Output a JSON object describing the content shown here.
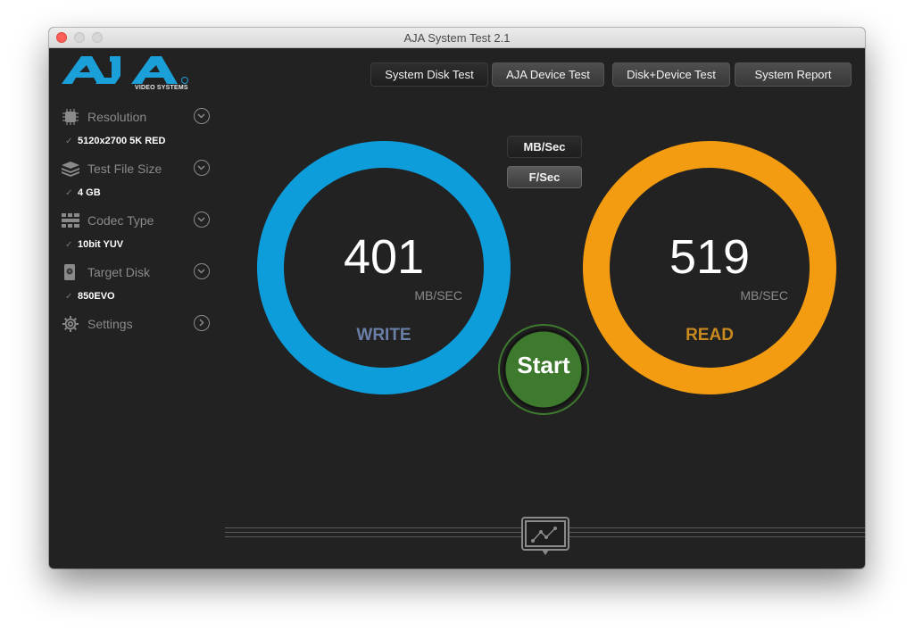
{
  "window": {
    "title": "AJA System Test 2.1"
  },
  "logo": {
    "brand": "AJA",
    "subtitle": "VIDEO SYSTEMS"
  },
  "sidebar": {
    "items": [
      {
        "label": "Resolution",
        "value": "5120x2700 5K RED",
        "icon": "chip-icon",
        "expander": "chevron-down-icon"
      },
      {
        "label": "Test File Size",
        "value": "4 GB",
        "icon": "stack-icon",
        "expander": "chevron-down-icon"
      },
      {
        "label": "Codec Type",
        "value": "10bit YUV",
        "icon": "grid-icon",
        "expander": "chevron-down-icon"
      },
      {
        "label": "Target Disk",
        "value": "850EVO",
        "icon": "disk-icon",
        "expander": "chevron-down-icon"
      },
      {
        "label": "Settings",
        "icon": "gear-icon",
        "expander": "chevron-right-icon"
      }
    ],
    "check_glyph": "✓"
  },
  "tabs": [
    {
      "label": "System Disk Test",
      "active": true
    },
    {
      "label": "AJA Device Test",
      "active": false
    },
    {
      "label": "Disk+Device Test",
      "active": false
    },
    {
      "label": "System Report",
      "active": false
    }
  ],
  "units": {
    "mb_label": "MB/Sec",
    "f_label": "F/Sec"
  },
  "write_gauge": {
    "value": "401",
    "unit": "MB/SEC",
    "label": "WRITE",
    "ring_color": "#0d9ddb",
    "label_color": "#6a7fa8"
  },
  "read_gauge": {
    "value": "519",
    "unit": "MB/SEC",
    "label": "READ",
    "ring_color": "#f39c12",
    "label_color": "#c8891e"
  },
  "start_button": {
    "label": "Start",
    "color": "#3e7a2e"
  },
  "graph_toggle": {
    "icon": "line-graph-icon"
  },
  "colors": {
    "background": "#222222",
    "brand_blue": "#1b9fd9"
  }
}
